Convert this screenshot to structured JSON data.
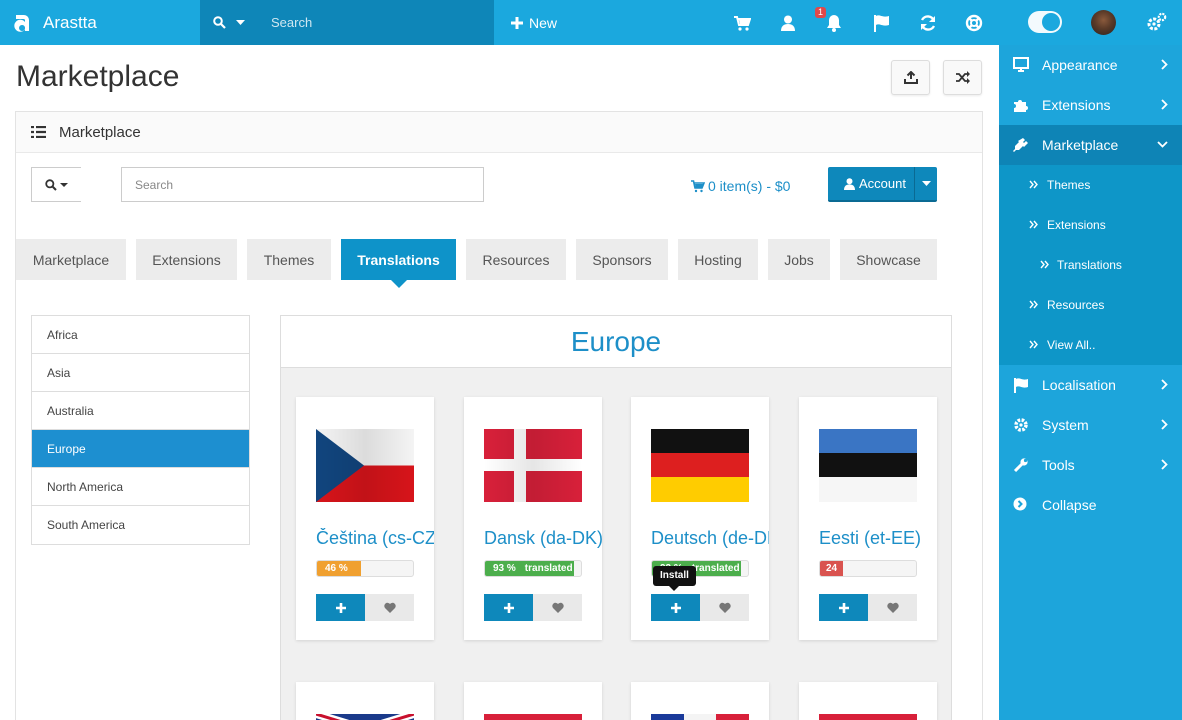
{
  "topbar": {
    "brand": "Arastta",
    "search_placeholder": "Search",
    "new_label": "New",
    "notification_count": "1",
    "icons": [
      "cart-icon",
      "user-icon",
      "bell-icon",
      "flag-icon",
      "refresh-icon",
      "lifebuoy-icon"
    ]
  },
  "sidebar": {
    "items": [
      {
        "label": "Appearance",
        "icon": "monitor-icon"
      },
      {
        "label": "Extensions",
        "icon": "puzzle-icon"
      },
      {
        "label": "Marketplace",
        "icon": "plug-icon"
      }
    ],
    "submenu": [
      {
        "label": "Themes"
      },
      {
        "label": "Extensions"
      },
      {
        "label": "Translations"
      },
      {
        "label": "Resources"
      },
      {
        "label": "View All.."
      }
    ],
    "items_after": [
      {
        "label": "Localisation",
        "icon": "flag-icon"
      },
      {
        "label": "System",
        "icon": "cog-icon"
      },
      {
        "label": "Tools",
        "icon": "wrench-icon"
      },
      {
        "label": "Collapse",
        "icon": "collapse-icon"
      }
    ]
  },
  "page": {
    "title": "Marketplace",
    "panel_title": "Marketplace"
  },
  "toolbar": {
    "search_placeholder": "Search",
    "cart_text": "0 item(s) - $0",
    "account_label": "Account"
  },
  "tabs": [
    {
      "label": "Marketplace",
      "active": false
    },
    {
      "label": "Extensions",
      "active": false
    },
    {
      "label": "Themes",
      "active": false
    },
    {
      "label": "Translations",
      "active": true
    },
    {
      "label": "Resources",
      "active": false
    },
    {
      "label": "Sponsors",
      "active": false
    },
    {
      "label": "Hosting",
      "active": false
    },
    {
      "label": "Jobs",
      "active": false
    },
    {
      "label": "Showcase",
      "active": false
    }
  ],
  "regions": [
    {
      "label": "Africa",
      "active": false
    },
    {
      "label": "Asia",
      "active": false
    },
    {
      "label": "Australia",
      "active": false
    },
    {
      "label": "Europe",
      "active": true
    },
    {
      "label": "North America",
      "active": false
    },
    {
      "label": "South America",
      "active": false
    }
  ],
  "region_heading": "Europe",
  "translations": [
    {
      "name": "Čeština (cs-CZ)",
      "percent": 46,
      "progress_text": "46 %",
      "status": "",
      "color": "#f0a030"
    },
    {
      "name": "Dansk (da-DK)",
      "percent": 93,
      "progress_text": "93 %",
      "status": "translated",
      "color": "#4cae4c"
    },
    {
      "name": "Deutsch (de-DE)",
      "percent": 93,
      "progress_text": "93 %",
      "status": "translated",
      "color": "#4cae4c"
    },
    {
      "name": "Eesti (et-EE)",
      "percent": 24,
      "progress_text": "24",
      "status": "",
      "color": "#d9534f"
    }
  ],
  "install_tooltip": "Install",
  "colors": {
    "accent": "#1ba8de",
    "primary_button": "#0e88bb",
    "heading": "#1d8fc8"
  }
}
